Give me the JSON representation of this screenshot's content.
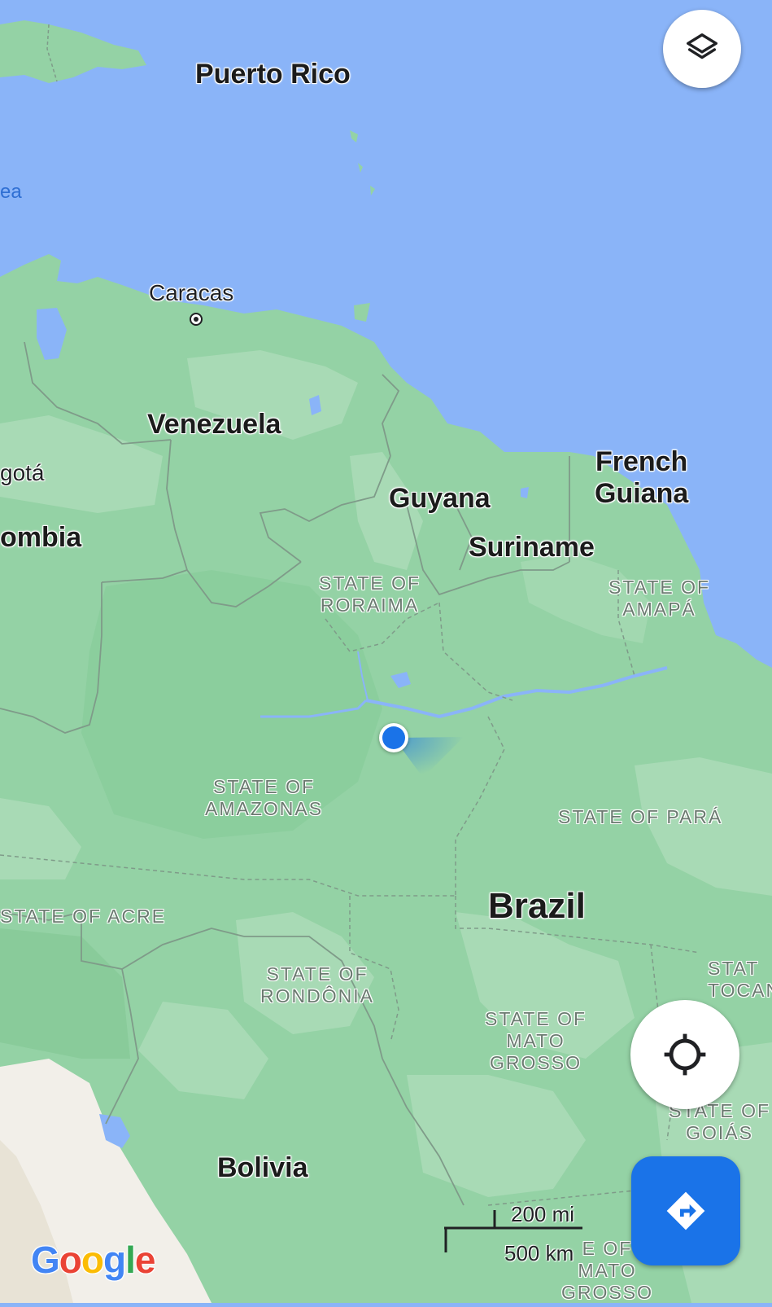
{
  "map": {
    "countries": {
      "puerto_rico": "Puerto Rico",
      "venezuela": "Venezuela",
      "colombia": "ombia",
      "guyana": "Guyana",
      "suriname": "Suriname",
      "french_guiana_1": "French",
      "french_guiana_2": "Guiana",
      "brazil": "Brazil",
      "bolivia": "Bolivia"
    },
    "cities": {
      "caracas": "Caracas",
      "bogota": "gotá"
    },
    "water": {
      "sea": "ea"
    },
    "states": {
      "roraima_1": "STATE OF",
      "roraima_2": "RORAIMA",
      "amapa_1": "STATE OF",
      "amapa_2": "AMAPÁ",
      "amazonas_1": "STATE OF",
      "amazonas_2": "AMAZONAS",
      "para": "STATE OF PARÁ",
      "acre": "STATE OF ACRE",
      "rondonia_1": "STATE OF",
      "rondonia_2": "RONDÔNIA",
      "mato_grosso_1": "STATE OF",
      "mato_grosso_2": "MATO",
      "mato_grosso_3": "GROSSO",
      "tocantins_1": "STAT",
      "tocantins_2": "TOCAN",
      "goias_1": "STATE OF",
      "goias_2": "GOIÁS",
      "mato_grosso_sul_1": "E OF",
      "mato_grosso_sul_2": "MATO",
      "mato_grosso_sul_3": "GROSSO"
    },
    "scale": {
      "imperial": "200 mi",
      "metric": "500 km"
    },
    "logo": {
      "letters": [
        "G",
        "o",
        "o",
        "g",
        "l",
        "e"
      ],
      "colors": [
        "#4285f4",
        "#ea4335",
        "#fbbc05",
        "#4285f4",
        "#34a853",
        "#ea4335"
      ]
    }
  },
  "controls": {
    "layers_icon": "layers-icon",
    "my_location_icon": "my-location-icon",
    "directions_icon": "directions-icon"
  },
  "colors": {
    "water": "#8ab4f8",
    "land": "#94d2a5",
    "land_light": "#a8dab5",
    "land_dark": "#84c896",
    "desert": "#f2efe9",
    "accent": "#1a73e8",
    "location_dot": "#1a73e8"
  }
}
